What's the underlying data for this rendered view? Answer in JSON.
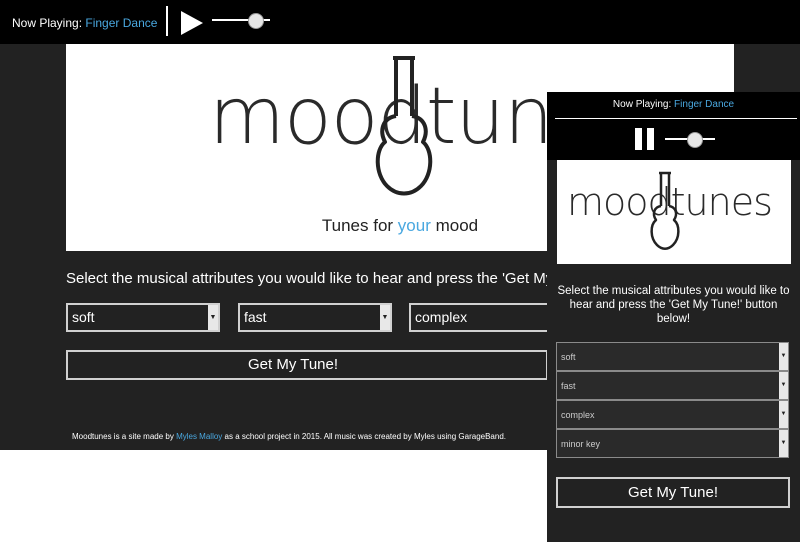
{
  "player": {
    "now_playing_label": "Now Playing:",
    "song": "Finger Dance",
    "volume_fraction": 0.85
  },
  "brand": {
    "logo_text": "moodtunes",
    "tagline_pre": "Tunes for ",
    "tagline_highlight": "your",
    "tagline_post": " mood"
  },
  "form": {
    "instructions_desktop": "Select the musical attributes you would like to hear and press the 'Get My",
    "instructions_mobile": "Select the musical attributes you would like to hear and press the 'Get My Tune!' button below!",
    "selects": [
      "soft",
      "fast",
      "complex",
      "minor key"
    ],
    "button_label": "Get My Tune!"
  },
  "footer": {
    "text_pre": "Moodtunes is a site made by ",
    "author_link": "Myles Malloy",
    "text_post": " as a school project in 2015. All music was created by Myles using GarageBand."
  },
  "mobile_player": {
    "now_playing_label": "Now Playing:",
    "song": "Finger Dance",
    "volume_fraction": 0.65
  },
  "colors": {
    "accent": "#4aa8e0",
    "background": "#222222",
    "bar": "#000000"
  }
}
